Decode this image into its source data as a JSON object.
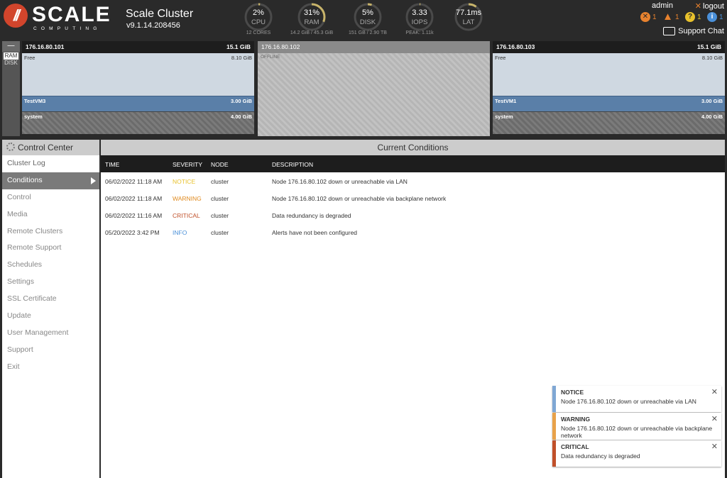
{
  "brand": {
    "logo_text": "SCALE",
    "logo_sub": "COMPUTING"
  },
  "cluster": {
    "name": "Scale Cluster",
    "version": "v9.1.14.208456"
  },
  "gauges": [
    {
      "value": "2%",
      "label": "CPU",
      "sub": "12 CORES",
      "percent": 2
    },
    {
      "value": "31%",
      "label": "RAM",
      "sub": "14.2 GiB / 45.3 GiB",
      "percent": 31
    },
    {
      "value": "5%",
      "label": "DISK",
      "sub": "151 GB / 2.90 TB",
      "percent": 5
    },
    {
      "value": "3.33",
      "label": "IOPS",
      "sub": "PEAK: 1.11k",
      "percent": 1
    },
    {
      "value": "77.1ms",
      "label": "LAT",
      "sub": "",
      "percent": 10
    }
  ],
  "user": {
    "name": "admin",
    "logout_label": "logout"
  },
  "alerts": {
    "critical": "1",
    "warning": "1",
    "notice": "1",
    "info": "1"
  },
  "support_label": "Support Chat",
  "toggle": {
    "collapse": "—",
    "ram": "RAM",
    "disk": "DISK"
  },
  "nodes": [
    {
      "ip": "176.16.80.101",
      "capacity": "15.1 GiB",
      "free_label": "Free",
      "free_amount": "8.10 GiB",
      "vm_name": "TestVM3",
      "vm_amount": "3.00 GiB",
      "system_label": "system",
      "system_amount": "4.00 GiB"
    },
    {
      "ip": "176.16.80.102",
      "status": "OFFLINE"
    },
    {
      "ip": "176.16.80.103",
      "capacity": "15.1 GiB",
      "free_label": "Free",
      "free_amount": "8.10 GiB",
      "vm_name": "TestVM1",
      "vm_amount": "3.00 GiB",
      "system_label": "system",
      "system_amount": "4.00 GiB"
    }
  ],
  "sidebar": {
    "title": "Control Center",
    "items": [
      {
        "label": "Cluster Log"
      },
      {
        "label": "Conditions"
      },
      {
        "label": "Control"
      },
      {
        "label": "Media"
      },
      {
        "label": "Remote Clusters"
      },
      {
        "label": "Remote Support"
      },
      {
        "label": "Schedules"
      },
      {
        "label": "Settings"
      },
      {
        "label": "SSL Certificate"
      },
      {
        "label": "Update"
      },
      {
        "label": "User Management"
      },
      {
        "label": "Support"
      },
      {
        "label": "Exit"
      }
    ]
  },
  "main": {
    "title": "Current Conditions",
    "columns": [
      "TIME",
      "SEVERITY",
      "NODE",
      "DESCRIPTION"
    ],
    "rows": [
      {
        "time": "06/02/2022 11:18 AM",
        "severity": "NOTICE",
        "node": "cluster",
        "description": "Node 176.16.80.102 down or unreachable via LAN"
      },
      {
        "time": "06/02/2022 11:18 AM",
        "severity": "WARNING",
        "node": "cluster",
        "description": "Node 176.16.80.102 down or unreachable via backplane network"
      },
      {
        "time": "06/02/2022 11:16 AM",
        "severity": "CRITICAL",
        "node": "cluster",
        "description": "Data redundancy is degraded"
      },
      {
        "time": "05/20/2022 3:42 PM",
        "severity": "INFO",
        "node": "cluster",
        "description": "Alerts have not been configured"
      }
    ]
  },
  "toasts": [
    {
      "title": "NOTICE",
      "message": "Node 176.16.80.102 down or unreachable via LAN"
    },
    {
      "title": "WARNING",
      "message": "Node 176.16.80.102 down or unreachable via backplane network"
    },
    {
      "title": "CRITICAL",
      "message": "Data redundancy is degraded"
    }
  ],
  "colors": {
    "notice": "#e8c12c",
    "warning": "#e08a1e",
    "critical": "#c0502a",
    "info": "#4a90d9",
    "brand": "#d2452c"
  }
}
